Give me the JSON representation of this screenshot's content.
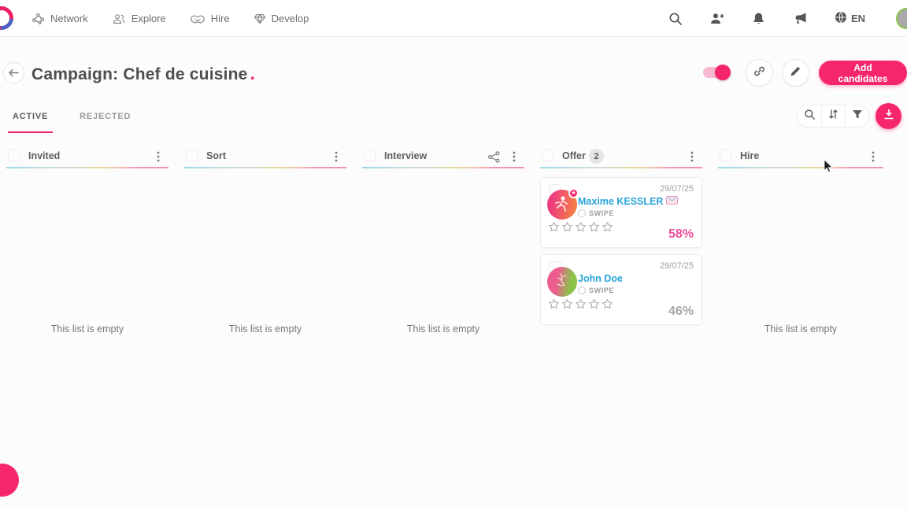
{
  "brand": {
    "accent_color": "#f6266e",
    "title_dot": "."
  },
  "nav": {
    "items": [
      {
        "label": "Network",
        "icon": "network-icon"
      },
      {
        "label": "Explore",
        "icon": "explore-icon"
      },
      {
        "label": "Hire",
        "icon": "hire-icon"
      },
      {
        "label": "Develop",
        "icon": "develop-icon"
      }
    ],
    "language": "EN",
    "right_icons": [
      "search-icon",
      "person-add-icon",
      "bell-icon",
      "megaphone-icon",
      "globe-icon",
      "user-avatar"
    ]
  },
  "header": {
    "title": "Campaign: Chef de cuisine",
    "toggle_on": true,
    "icon_buttons": [
      "link-icon",
      "pencil-icon"
    ],
    "add_candidates_label": "Add candidates"
  },
  "tabs": [
    {
      "label": "ACTIVE",
      "selected": true
    },
    {
      "label": "REJECTED",
      "selected": false
    }
  ],
  "toolbar": {
    "icons": [
      "search-icon",
      "sort-icon",
      "filter-icon"
    ],
    "export_icon": "download-icon"
  },
  "board": {
    "empty_text": "This list is empty",
    "columns": [
      {
        "name": "Invited"
      },
      {
        "name": "Sort"
      },
      {
        "name": "Interview",
        "extra_icon": "share-icon"
      },
      {
        "name": "Offer",
        "count": "2"
      },
      {
        "name": "Hire"
      }
    ]
  },
  "cards": [
    {
      "date": "29/07/25",
      "name": "Maxime KESSLER",
      "source": "SWIPE",
      "rating": 0,
      "score": "58%",
      "score_color": "#f0509b"
    },
    {
      "date": "29/07/25",
      "name": "John Doe",
      "source": "SWIPE",
      "rating": 0,
      "score": "46%",
      "score_color": "#a8a8a8"
    }
  ]
}
